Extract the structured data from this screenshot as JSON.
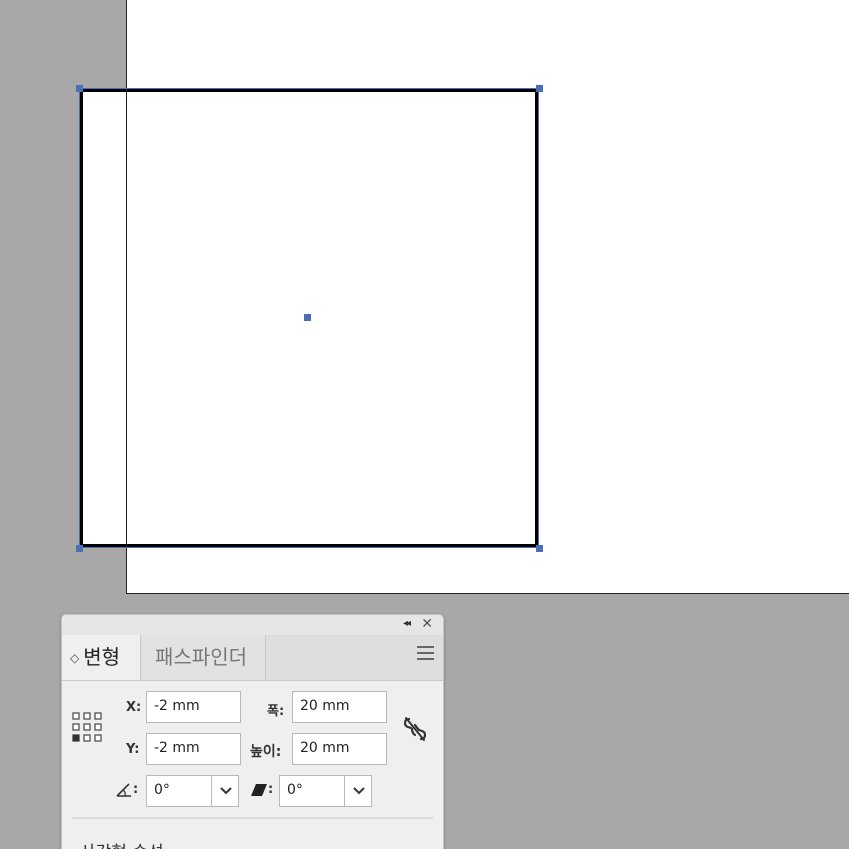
{
  "panel": {
    "collapse_glyph": "◂◂",
    "close_glyph": "✕",
    "tabs": [
      {
        "label": "변형",
        "active": true
      },
      {
        "label": "패스파인더",
        "active": false
      }
    ],
    "fields": {
      "x_label": "X:",
      "x_value": "-2 mm",
      "y_label": "Y:",
      "y_value": "-2 mm",
      "width_label": "폭:",
      "width_value": "20 mm",
      "height_label": "높이:",
      "height_value": "20 mm",
      "rotate_label": ":",
      "rotate_value": "0°",
      "shear_label": ":",
      "shear_value": "0°"
    },
    "section_label": "사각형 속성:"
  },
  "colors": {
    "selection": "#4a6fb5",
    "pasteboard": "#a8a8a8",
    "artboard": "#ffffff"
  },
  "icons": {
    "reference_point": "reference-point-icon",
    "constrain_proportions": "unlink-icon",
    "menu": "hamburger-menu-icon"
  }
}
